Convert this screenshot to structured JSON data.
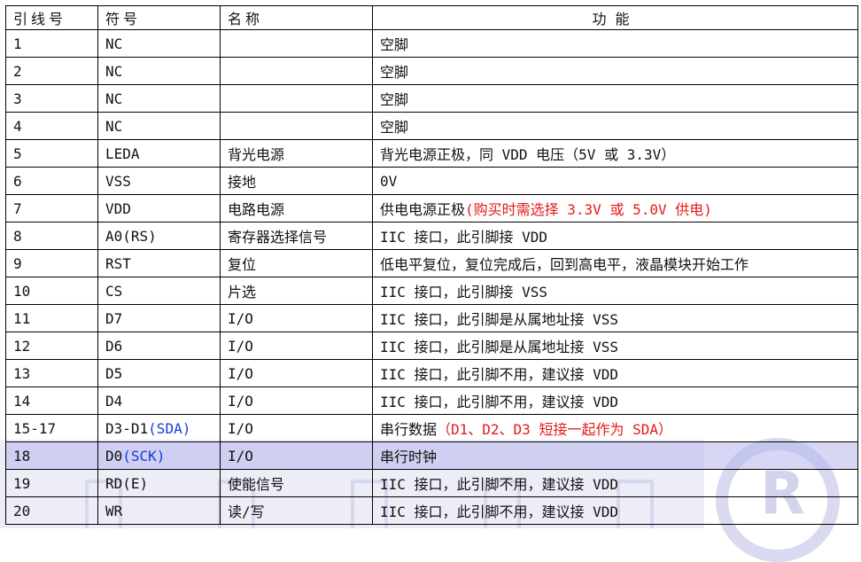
{
  "headers": [
    "引线号",
    "符号",
    "名称",
    "功能"
  ],
  "rows": [
    {
      "pin": "1",
      "sym": "NC",
      "name": "",
      "func": "空脚"
    },
    {
      "pin": "2",
      "sym": "NC",
      "name": "",
      "func": "空脚"
    },
    {
      "pin": "3",
      "sym": "NC",
      "name": "",
      "func": "空脚"
    },
    {
      "pin": "4",
      "sym": "NC",
      "name": "",
      "func": "空脚"
    },
    {
      "pin": "5",
      "sym": "LEDA",
      "name": "背光电源",
      "func": "背光电源正极，同 VDD 电压（5V 或 3.3V）"
    },
    {
      "pin": "6",
      "sym": "VSS",
      "name": "接地",
      "func": "0V"
    },
    {
      "pin": "7",
      "sym": "VDD",
      "name": "电路电源",
      "func": "供电电源正极",
      "func_note": "(购买时需选择 3.3V 或 5.0V 供电)"
    },
    {
      "pin": "8",
      "sym": "A0(RS)",
      "name": "寄存器选择信号",
      "func": "IIC 接口，此引脚接 VDD"
    },
    {
      "pin": "9",
      "sym": "RST",
      "name": "复位",
      "func": "低电平复位，复位完成后，回到高电平，液晶模块开始工作"
    },
    {
      "pin": "10",
      "sym": "CS",
      "name": "片选",
      "func": "IIC 接口，此引脚接 VSS"
    },
    {
      "pin": "11",
      "sym": "D7",
      "name": "I/O",
      "func": "IIC 接口，此引脚是从属地址接 VSS"
    },
    {
      "pin": "12",
      "sym": "D6",
      "name": "I/O",
      "func": "IIC 接口，此引脚是从属地址接 VSS"
    },
    {
      "pin": "13",
      "sym": "D5",
      "name": "I/O",
      "func": "IIC 接口，此引脚不用，建议接 VDD"
    },
    {
      "pin": "14",
      "sym": "D4",
      "name": "I/O",
      "func": "IIC 接口，此引脚不用，建议接 VDD"
    },
    {
      "pin": "15-17",
      "sym": "D3-D1",
      "sym_note": "(SDA)",
      "name": "I/O",
      "func": "串行数据",
      "func_note": "（D1、D2、D3 短接一起作为 SDA）"
    },
    {
      "pin": "18",
      "sym": "D0",
      "sym_note": "(SCK)",
      "name": "I/O",
      "func": "串行时钟",
      "highlight": true
    },
    {
      "pin": "19",
      "sym": "RD(E)",
      "name": "使能信号",
      "func": "IIC 接口，此引脚不用，建议接 VDD"
    },
    {
      "pin": "20",
      "sym": "WR",
      "name": "读/写",
      "func": "IIC 接口，此引脚不用，建议接 VDD"
    }
  ],
  "colors": {
    "note_red": "#e21a1a",
    "note_blue": "#1a3bd6",
    "highlight": "#b4b6eb"
  }
}
